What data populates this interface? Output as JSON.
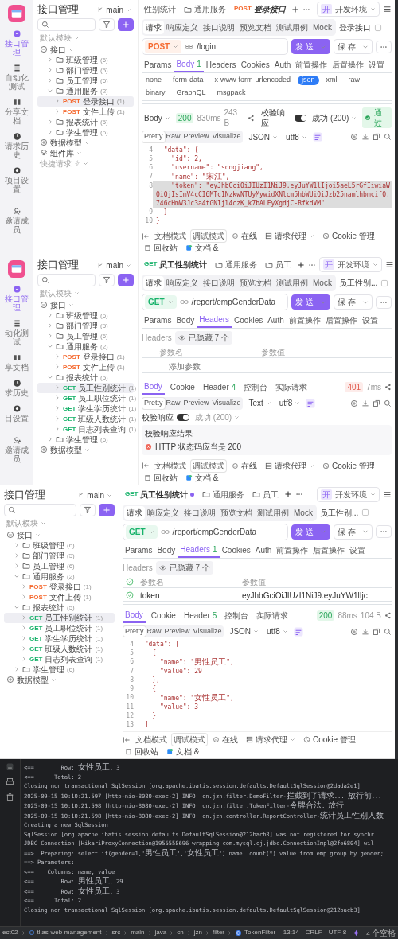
{
  "windows": [
    {
      "rail": {
        "items": [
          {
            "label": "接口管理",
            "selected": true
          },
          {
            "label": "自动化测试",
            "selected": false
          },
          {
            "label": "分享文档",
            "selected": false
          },
          {
            "label": "请求历史",
            "selected": false
          },
          {
            "label": "项目设置",
            "selected": false
          },
          {
            "label": "邀请成员",
            "selected": false
          }
        ]
      },
      "sidebar": {
        "title": "接口管理",
        "branch": "main",
        "module": "默认模块",
        "tree": [
          {
            "kind": "root",
            "label": "接口",
            "expanded": true,
            "children": [
              {
                "kind": "folder",
                "label": "班级管理",
                "count": "(6)",
                "expanded": false,
                "selected": false
              },
              {
                "kind": "folder",
                "label": "部门管理",
                "count": "(5)",
                "expanded": false,
                "selected": false
              },
              {
                "kind": "folder",
                "label": "员工管理",
                "count": "(6)",
                "expanded": false,
                "selected": false
              },
              {
                "kind": "folder",
                "label": "通用服务",
                "count": "(2)",
                "expanded": true,
                "selected": false,
                "children": [
                  {
                    "kind": "api",
                    "method": "POST",
                    "label": "登录接口",
                    "count": "(1)",
                    "selected": true
                  },
                  {
                    "kind": "api",
                    "method": "POST",
                    "label": "文件上传",
                    "count": "(1)",
                    "selected": false
                  }
                ]
              },
              {
                "kind": "folder",
                "label": "报表统计",
                "count": "(5)",
                "expanded": false,
                "selected": false
              },
              {
                "kind": "folder",
                "label": "学生管理",
                "count": "(6)",
                "expanded": false,
                "selected": false
              }
            ]
          },
          {
            "kind": "model",
            "label": "数据模型"
          },
          {
            "kind": "library",
            "label": "组件库"
          },
          {
            "kind": "quick",
            "label": "快捷请求"
          }
        ]
      },
      "tabs": [
        {
          "kind": "plain",
          "label": "性别统计",
          "selected": false
        },
        {
          "kind": "folder",
          "label": "通用服务",
          "selected": false
        },
        {
          "kind": "api",
          "method": "POST",
          "label": "登录接口",
          "selected": true,
          "unsaved": false
        }
      ],
      "env": {
        "badge": "开",
        "label": "开发环境"
      },
      "subtabs": [
        {
          "label": "请求",
          "selected": true
        },
        {
          "label": "响应定义",
          "selected": false
        },
        {
          "label": "接口说明",
          "selected": false
        },
        {
          "label": "预览文档",
          "selected": false
        },
        {
          "label": "测试用例",
          "selected": false
        },
        {
          "label": "Mock",
          "selected": false
        }
      ],
      "subtitle": "登录接口",
      "method": "POST",
      "url": "/login",
      "send": "发 送",
      "save": "保 存",
      "param_tabs": [
        {
          "label": "Params",
          "selected": false
        },
        {
          "label": "Body",
          "count": "1",
          "selected": true
        },
        {
          "label": "Headers",
          "selected": false
        },
        {
          "label": "Cookies",
          "selected": false
        },
        {
          "label": "Auth",
          "selected": false
        },
        {
          "label": "前置操作",
          "selected": false
        },
        {
          "label": "后置操作",
          "selected": false
        },
        {
          "label": "设置",
          "selected": false
        }
      ],
      "body_types": [
        {
          "label": "none",
          "selected": false
        },
        {
          "label": "form-data",
          "selected": false
        },
        {
          "label": "x-www-form-urlencoded",
          "selected": false
        },
        {
          "label": "json",
          "selected": true
        },
        {
          "label": "xml",
          "selected": false
        },
        {
          "label": "raw",
          "selected": false
        },
        {
          "label": "binary",
          "selected": false
        },
        {
          "label": "GraphQL",
          "selected": false
        },
        {
          "label": "msgpack",
          "selected": false
        }
      ],
      "response": {
        "label": "Body",
        "status": "200",
        "ok": true,
        "time": "830ms",
        "size": "243 B",
        "header_validate": {
          "label": "校验响应",
          "on": true,
          "result": "成功 (200)",
          "pass": "通过"
        },
        "views": [
          {
            "label": "Pretty",
            "selected": true
          },
          {
            "label": "Raw",
            "selected": false
          },
          {
            "label": "Preview",
            "selected": false
          },
          {
            "label": "Visualize",
            "selected": false
          }
        ],
        "format": "JSON",
        "encoding": "utf8",
        "code": [
          {
            "n": "4",
            "text": "  \"data\": {",
            "selected": false
          },
          {
            "n": "5",
            "text": "    \"id\": 2,",
            "selected": false
          },
          {
            "n": "6",
            "text": "    \"username\": \"songjiang\",",
            "selected": false
          },
          {
            "n": "7",
            "text": "    \"name\": \"宋江\",",
            "selected": false
          },
          {
            "n": "8",
            "text": "    \"token\": \"eyJhbGciOiJIUzI1NiJ9.eyJuYW1lIjoi5aeL5rGfIiwiaWQiOjIsImV4cCI6MTc1NzkwNTUyMywidXNlcm5hbWUiOiJzb25namlhbmcifQ.746cHmW3Jc3a4tGNIjl4czK_k7bALEyXgdjC-RfkdVM\"",
            "selected": true
          },
          {
            "n": "9",
            "text": "  }",
            "selected": false
          },
          {
            "n": "10",
            "text": "}",
            "selected": false
          }
        ]
      },
      "footer": [
        {
          "kind": "collapse"
        },
        {
          "kind": "mode",
          "label": "文档模式",
          "selected": false
        },
        {
          "kind": "mode",
          "label": "调试模式",
          "selected": true
        },
        {
          "kind": "online",
          "label": "在线"
        },
        {
          "kind": "proxy",
          "label": "请求代理"
        },
        {
          "kind": "cookie",
          "label": "Cookie 管理"
        },
        {
          "kind": "trash",
          "label": "回收站"
        },
        {
          "kind": "doc",
          "label": "文档 &"
        }
      ]
    },
    {
      "rail": {
        "items": [
          {
            "label": "接口管理",
            "selected": true
          },
          {
            "label": "动化测试",
            "selected": false
          },
          {
            "label": "享文档",
            "selected": false
          },
          {
            "label": "求历史",
            "selected": false
          },
          {
            "label": "目设置",
            "selected": false
          },
          {
            "label": "邀请成员",
            "selected": false
          }
        ]
      },
      "sidebar": {
        "title": "接口管理",
        "branch": "main",
        "module": "默认模块",
        "tree": [
          {
            "kind": "root",
            "label": "接口",
            "expanded": true,
            "children": [
              {
                "kind": "folder",
                "label": "班级管理",
                "count": "(6)",
                "expanded": false,
                "selected": false
              },
              {
                "kind": "folder",
                "label": "部门管理",
                "count": "(5)",
                "expanded": false,
                "selected": false
              },
              {
                "kind": "folder",
                "label": "员工管理",
                "count": "(6)",
                "expanded": false,
                "selected": false
              },
              {
                "kind": "folder",
                "label": "通用服务",
                "count": "(2)",
                "expanded": true,
                "selected": false,
                "children": [
                  {
                    "kind": "api",
                    "method": "POST",
                    "label": "登录接口",
                    "count": "(1)",
                    "selected": false
                  },
                  {
                    "kind": "api",
                    "method": "POST",
                    "label": "文件上传",
                    "count": "(1)",
                    "selected": false
                  }
                ]
              },
              {
                "kind": "folder",
                "label": "报表统计",
                "count": "(5)",
                "expanded": true,
                "selected": false,
                "children": [
                  {
                    "kind": "api",
                    "method": "GET",
                    "label": "员工性别统计",
                    "count": "(1)",
                    "selected": true
                  },
                  {
                    "kind": "api",
                    "method": "GET",
                    "label": "员工职位统计",
                    "count": "(1)",
                    "selected": false
                  },
                  {
                    "kind": "api",
                    "method": "GET",
                    "label": "学生学历统计",
                    "count": "(1)",
                    "selected": false
                  },
                  {
                    "kind": "api",
                    "method": "GET",
                    "label": "班级人数统计",
                    "count": "(1)",
                    "selected": false
                  },
                  {
                    "kind": "api",
                    "method": "GET",
                    "label": "日志列表查询",
                    "count": "(1)",
                    "selected": false
                  }
                ]
              },
              {
                "kind": "folder",
                "label": "学生管理",
                "count": "(6)",
                "expanded": false,
                "selected": false
              }
            ]
          },
          {
            "kind": "model",
            "label": "数据模型"
          }
        ]
      },
      "tabs": [
        {
          "kind": "api",
          "method": "GET",
          "label": "员工性别统计",
          "selected": true,
          "unsaved": false
        },
        {
          "kind": "folder",
          "label": "通用服务",
          "selected": false
        },
        {
          "kind": "folder",
          "label": "员工",
          "selected": false
        }
      ],
      "env": {
        "badge": "开",
        "label": "开发环境"
      },
      "subtabs": [
        {
          "label": "请求",
          "selected": true
        },
        {
          "label": "响应定义",
          "selected": false
        },
        {
          "label": "接口说明",
          "selected": false
        },
        {
          "label": "预览文档",
          "selected": false
        },
        {
          "label": "测试用例",
          "selected": false
        },
        {
          "label": "Mock",
          "selected": false
        }
      ],
      "subtitle": "员工性别...",
      "method": "GET",
      "url": "/report/empGenderData",
      "send": "发 送",
      "save": "保 存",
      "param_tabs": [
        {
          "label": "Params",
          "selected": false
        },
        {
          "label": "Body",
          "selected": false
        },
        {
          "label": "Headers",
          "selected": true
        },
        {
          "label": "Cookies",
          "selected": false
        },
        {
          "label": "Auth",
          "selected": false
        },
        {
          "label": "前置操作",
          "selected": false
        },
        {
          "label": "后置操作",
          "selected": false
        },
        {
          "label": "设置",
          "selected": false
        }
      ],
      "headers": {
        "label": "Headers",
        "hidden": "已隐藏 7 个",
        "columns": [
          "参数名",
          "参数值"
        ],
        "placeholder": "添加参数"
      },
      "response": {
        "tabs": [
          {
            "label": "Body",
            "selected": true
          },
          {
            "label": "Cookie",
            "selected": false
          },
          {
            "label": "Header",
            "count": "4",
            "selected": false
          },
          {
            "label": "控制台",
            "selected": false
          },
          {
            "label": "实际请求",
            "selected": false
          }
        ],
        "status": "401",
        "ok": false,
        "time": "7ms",
        "views": [
          {
            "label": "Pretty",
            "selected": true
          },
          {
            "label": "Raw",
            "selected": false
          },
          {
            "label": "Preview",
            "selected": false
          },
          {
            "label": "Visualize",
            "selected": false
          }
        ],
        "format": "Text",
        "encoding": "utf8",
        "validate": {
          "label": "校验响应",
          "on": true,
          "result": "成功 (200)",
          "title": "校验响应结果",
          "errors": [
            "HTTP 状态码应当是 200"
          ]
        }
      },
      "footer": [
        {
          "kind": "collapse"
        },
        {
          "kind": "mode",
          "label": "文档模式",
          "selected": false
        },
        {
          "kind": "mode",
          "label": "调试模式",
          "selected": true
        },
        {
          "kind": "online",
          "label": "在线"
        },
        {
          "kind": "proxy",
          "label": "请求代理"
        },
        {
          "kind": "cookie",
          "label": "Cookie 管理"
        },
        {
          "kind": "trash",
          "label": "回收站"
        },
        {
          "kind": "doc",
          "label": "文档 &"
        }
      ]
    },
    {
      "sidebar": {
        "title": "接口管理",
        "branch": "main",
        "module": "默认模块",
        "tree": [
          {
            "kind": "root",
            "label": "接口",
            "expanded": true,
            "children": [
              {
                "kind": "folder",
                "label": "班级管理",
                "count": "(6)",
                "expanded": false,
                "selected": false
              },
              {
                "kind": "folder",
                "label": "部门管理",
                "count": "(5)",
                "expanded": false,
                "selected": false
              },
              {
                "kind": "folder",
                "label": "员工管理",
                "count": "(6)",
                "expanded": false,
                "selected": false
              },
              {
                "kind": "folder",
                "label": "通用服务",
                "count": "(2)",
                "expanded": true,
                "selected": false,
                "children": [
                  {
                    "kind": "api",
                    "method": "POST",
                    "label": "登录接口",
                    "count": "(1)",
                    "selected": false
                  },
                  {
                    "kind": "api",
                    "method": "POST",
                    "label": "文件上传",
                    "count": "(1)",
                    "selected": false
                  }
                ]
              },
              {
                "kind": "folder",
                "label": "报表统计",
                "count": "(5)",
                "expanded": true,
                "selected": false,
                "children": [
                  {
                    "kind": "api",
                    "method": "GET",
                    "label": "员工性别统计",
                    "count": "(1)",
                    "selected": true
                  },
                  {
                    "kind": "api",
                    "method": "GET",
                    "label": "员工职位统计",
                    "count": "(1)",
                    "selected": false
                  },
                  {
                    "kind": "api",
                    "method": "GET",
                    "label": "学生学历统计",
                    "count": "(1)",
                    "selected": false
                  },
                  {
                    "kind": "api",
                    "method": "GET",
                    "label": "班级人数统计",
                    "count": "(1)",
                    "selected": false
                  },
                  {
                    "kind": "api",
                    "method": "GET",
                    "label": "日志列表查询",
                    "count": "(1)",
                    "selected": false
                  }
                ]
              },
              {
                "kind": "folder",
                "label": "学生管理",
                "count": "(6)",
                "expanded": false,
                "selected": false
              }
            ]
          },
          {
            "kind": "model",
            "label": "数据模型"
          }
        ]
      },
      "tabs": [
        {
          "kind": "api",
          "method": "GET",
          "label": "员工性别统计",
          "selected": true,
          "unsaved": true
        },
        {
          "kind": "folder",
          "label": "通用服务",
          "selected": false
        },
        {
          "kind": "folder",
          "label": "员工",
          "selected": false
        }
      ],
      "env": {
        "badge": "开",
        "label": "开发环境"
      },
      "subtabs": [
        {
          "label": "请求",
          "selected": true
        },
        {
          "label": "响应定义",
          "selected": false
        },
        {
          "label": "接口说明",
          "selected": false
        },
        {
          "label": "预览文档",
          "selected": false
        },
        {
          "label": "测试用例",
          "selected": false
        },
        {
          "label": "Mock",
          "selected": false
        }
      ],
      "subtitle": "员工性别...",
      "method": "GET",
      "url": "/report/empGenderData",
      "send": "发 送",
      "save": "保 存",
      "param_tabs": [
        {
          "label": "Params",
          "selected": false
        },
        {
          "label": "Body",
          "selected": false
        },
        {
          "label": "Headers",
          "count": "1",
          "selected": true
        },
        {
          "label": "Cookies",
          "selected": false
        },
        {
          "label": "Auth",
          "selected": false
        },
        {
          "label": "前置操作",
          "selected": false
        },
        {
          "label": "后置操作",
          "selected": false
        },
        {
          "label": "设置",
          "selected": false
        }
      ],
      "headers": {
        "label": "Headers",
        "hidden": "已隐藏 7 个",
        "columns": [
          "参数名",
          "参数值"
        ],
        "header_checked": true,
        "rows": [
          {
            "checked": true,
            "name": "token",
            "value": "eyJhbGciOiJIUzI1NiJ9.eyJuYW1lIjc"
          }
        ]
      },
      "response": {
        "tabs": [
          {
            "label": "Body",
            "selected": true
          },
          {
            "label": "Cookie",
            "selected": false
          },
          {
            "label": "Header",
            "count": "5",
            "selected": false
          },
          {
            "label": "控制台",
            "selected": false
          },
          {
            "label": "实际请求",
            "selected": false
          }
        ],
        "status": "200",
        "ok": true,
        "time": "88ms",
        "size": "104 B",
        "views": [
          {
            "label": "Pretty",
            "selected": true
          },
          {
            "label": "Raw",
            "selected": false
          },
          {
            "label": "Preview",
            "selected": false
          },
          {
            "label": "Visualize",
            "selected": false
          }
        ],
        "format": "JSON",
        "encoding": "utf8",
        "code": [
          {
            "n": "4",
            "text": "  \"data\": [",
            "selected": false
          },
          {
            "n": "5",
            "text": "    {",
            "selected": false
          },
          {
            "n": "6",
            "text": "      \"name\": \"男性员工\",",
            "selected": false
          },
          {
            "n": "7",
            "text": "      \"value\": 29",
            "selected": false
          },
          {
            "n": "8",
            "text": "    },",
            "selected": false
          },
          {
            "n": "9",
            "text": "    {",
            "selected": false
          },
          {
            "n": "10",
            "text": "      \"name\": \"女性员工\",",
            "selected": false
          },
          {
            "n": "11",
            "text": "      \"value\": 3",
            "selected": false
          },
          {
            "n": "12",
            "text": "    }",
            "selected": false
          },
          {
            "n": "13",
            "text": "  ]",
            "selected": false
          }
        ]
      },
      "footer": [
        {
          "kind": "collapse"
        },
        {
          "kind": "mode",
          "label": "文档模式",
          "selected": false
        },
        {
          "kind": "mode",
          "label": "调试模式",
          "selected": true
        },
        {
          "kind": "online",
          "label": "在线"
        },
        {
          "kind": "proxy",
          "label": "请求代理"
        },
        {
          "kind": "cookie",
          "label": "Cookie 管理"
        },
        {
          "kind": "trash",
          "label": "回收站"
        },
        {
          "kind": "doc",
          "label": "文档 &"
        }
      ]
    }
  ],
  "console": {
    "lines": [
      "<==        Row: 女性员工, 3",
      "<==      Total: 2",
      "Closing non transactional SqlSession [org.apache.ibatis.session.defaults.DefaultSqlSession@2dada2e1]",
      "2025-09-15 10:10:21.597 [http-nio-8080-exec-2] INFO  cn.jzn.filter.DemoFilter-拦截到了请求... 放行前...",
      "2025-09-15 10:10:21.598 [http-nio-8080-exec-2] INFO  cn.jzn.filter.TokenFilter-令牌合法, 放行",
      "2025-09-15 10:10:21.598 [http-nio-8080-exec-2] INFO  cn.jzn.controller.ReportController-统计员工性别人数",
      "Creating a new SqlSession",
      "SqlSession [org.apache.ibatis.session.defaults.DefaultSqlSession@212bacb3] was not registered for synchr",
      "JDBC Connection [HikariProxyConnection@1956558696 wrapping com.mysql.cj.jdbc.ConnectionImpl@2fe6804] wil",
      "==>  Preparing: select if(gender=1,'男性员工','女性员工') name, count(*) value from emp group by gender;",
      "==> Parameters: ",
      "<==    Columns: name, value",
      "<==        Row: 男性员工, 29",
      "<==        Row: 女性员工, 3",
      "<==      Total: 2",
      "Closing non transactional SqlSession [org.apache.ibatis.session.defaults.DefaultSqlSession@212bacb3]"
    ]
  },
  "status_bar": {
    "breadcrumbs": [
      "ect02",
      "tlias-web-management",
      "src",
      "main",
      "java",
      "cn",
      "jzn",
      "filter",
      "TokenFilter"
    ],
    "items": [
      "13:14",
      "CRLF",
      "UTF-8",
      "4 个空格"
    ]
  }
}
